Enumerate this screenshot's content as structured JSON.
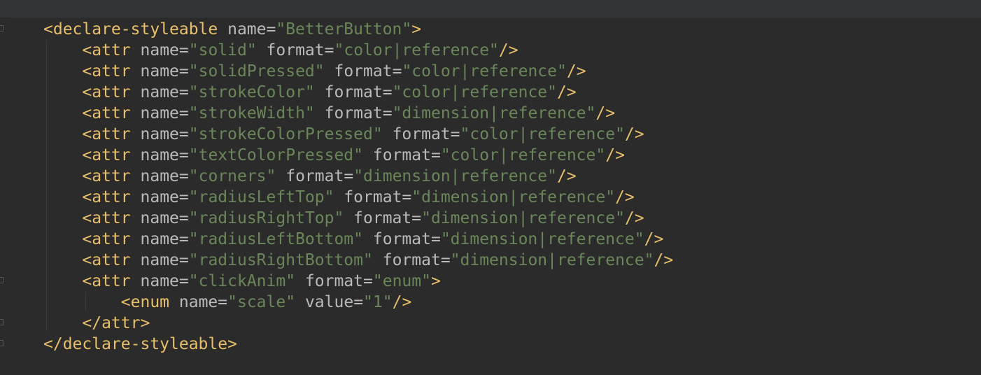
{
  "editor": {
    "language": "xml",
    "colors": {
      "background": "#2B2B2B",
      "tag": "#E8BF6A",
      "attribute": "#BABABA",
      "value": "#6A8759"
    },
    "lines": [
      {
        "indent": "",
        "tag_open": "<declare-styleable",
        "attrs": [
          {
            "name": "name",
            "value": "\"BetterButton\""
          }
        ],
        "tag_close": ">"
      },
      {
        "indent": "    ",
        "tag_open": "<attr",
        "attrs": [
          {
            "name": "name",
            "value": "\"solid\""
          },
          {
            "name": "format",
            "value": "\"color|reference\""
          }
        ],
        "tag_close": "/>"
      },
      {
        "indent": "    ",
        "tag_open": "<attr",
        "attrs": [
          {
            "name": "name",
            "value": "\"solidPressed\""
          },
          {
            "name": "format",
            "value": "\"color|reference\""
          }
        ],
        "tag_close": "/>"
      },
      {
        "indent": "    ",
        "tag_open": "<attr",
        "attrs": [
          {
            "name": "name",
            "value": "\"strokeColor\""
          },
          {
            "name": "format",
            "value": "\"color|reference\""
          }
        ],
        "tag_close": "/>"
      },
      {
        "indent": "    ",
        "tag_open": "<attr",
        "attrs": [
          {
            "name": "name",
            "value": "\"strokeWidth\""
          },
          {
            "name": "format",
            "value": "\"dimension|reference\""
          }
        ],
        "tag_close": "/>"
      },
      {
        "indent": "    ",
        "tag_open": "<attr",
        "attrs": [
          {
            "name": "name",
            "value": "\"strokeColorPressed\""
          },
          {
            "name": "format",
            "value": "\"color|reference\""
          }
        ],
        "tag_close": "/>"
      },
      {
        "indent": "    ",
        "tag_open": "<attr",
        "attrs": [
          {
            "name": "name",
            "value": "\"textColorPressed\""
          },
          {
            "name": "format",
            "value": "\"color|reference\""
          }
        ],
        "tag_close": "/>"
      },
      {
        "indent": "    ",
        "tag_open": "<attr",
        "attrs": [
          {
            "name": "name",
            "value": "\"corners\""
          },
          {
            "name": "format",
            "value": "\"dimension|reference\""
          }
        ],
        "tag_close": "/>"
      },
      {
        "indent": "    ",
        "tag_open": "<attr",
        "attrs": [
          {
            "name": "name",
            "value": "\"radiusLeftTop\""
          },
          {
            "name": "format",
            "value": "\"dimension|reference\""
          }
        ],
        "tag_close": "/>"
      },
      {
        "indent": "    ",
        "tag_open": "<attr",
        "attrs": [
          {
            "name": "name",
            "value": "\"radiusRightTop\""
          },
          {
            "name": "format",
            "value": "\"dimension|reference\""
          }
        ],
        "tag_close": "/>"
      },
      {
        "indent": "    ",
        "tag_open": "<attr",
        "attrs": [
          {
            "name": "name",
            "value": "\"radiusLeftBottom\""
          },
          {
            "name": "format",
            "value": "\"dimension|reference\""
          }
        ],
        "tag_close": "/>"
      },
      {
        "indent": "    ",
        "tag_open": "<attr",
        "attrs": [
          {
            "name": "name",
            "value": "\"radiusRightBottom\""
          },
          {
            "name": "format",
            "value": "\"dimension|reference\""
          }
        ],
        "tag_close": "/>"
      },
      {
        "indent": "    ",
        "tag_open": "<attr",
        "attrs": [
          {
            "name": "name",
            "value": "\"clickAnim\""
          },
          {
            "name": "format",
            "value": "\"enum\""
          }
        ],
        "tag_close": ">"
      },
      {
        "indent": "        ",
        "tag_open": "<enum",
        "attrs": [
          {
            "name": "name",
            "value": "\"scale\""
          },
          {
            "name": "value",
            "value": "\"1\""
          }
        ],
        "tag_close": "/>"
      },
      {
        "indent": "    ",
        "tag_open": "</attr",
        "attrs": [],
        "tag_close": ">"
      },
      {
        "indent": "",
        "tag_open": "</declare-styleable",
        "attrs": [],
        "tag_close": ">"
      }
    ]
  }
}
